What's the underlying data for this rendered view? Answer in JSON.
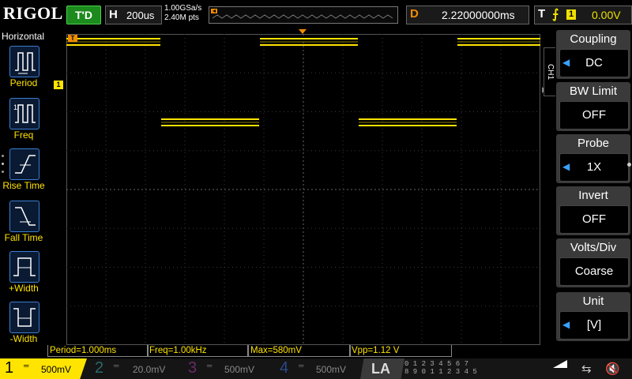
{
  "top": {
    "logo": "RIGOL",
    "run_state": "T'D",
    "horizontal_key": "H",
    "timebase": "200us",
    "sample_rate": "1.00GSa/s",
    "memory_points": "2.40M pts",
    "delay_key": "D",
    "delay_value": "2.22000000ms",
    "trigger_key": "T",
    "trigger_channel": "1",
    "trigger_level": "0.00V"
  },
  "left_menu": {
    "title": "Horizontal",
    "items": [
      {
        "label": "Period"
      },
      {
        "label": "Freq"
      },
      {
        "label": "Rise Time"
      },
      {
        "label": "Fall Time"
      },
      {
        "label": "+Width"
      },
      {
        "label": "-Width"
      }
    ]
  },
  "right_menu": {
    "channel_tab": "CH1",
    "items": [
      {
        "title": "Coupling",
        "value": "DC"
      },
      {
        "title": "BW Limit",
        "value": "OFF"
      },
      {
        "title": "Probe",
        "value": "1X"
      },
      {
        "title": "Invert",
        "value": "OFF"
      },
      {
        "title": "Volts/Div",
        "value": "Coarse"
      },
      {
        "title": "Unit",
        "value": "[V]"
      }
    ]
  },
  "markers": {
    "trigger_marker": "T",
    "ch1_marker": "1"
  },
  "measurements": {
    "period": "Period=1.000ms",
    "freq": "Freq=1.00kHz",
    "max": "Max=580mV",
    "vpp": "Vpp=1.12 V"
  },
  "channels": [
    {
      "num": "1",
      "scale": "500mV",
      "color": "#ffe400"
    },
    {
      "num": "2",
      "scale": "20.0mV",
      "color": "#00a0a0"
    },
    {
      "num": "3",
      "scale": "500mV",
      "color": "#c000c0"
    },
    {
      "num": "4",
      "scale": "500mV",
      "color": "#2f6fd8"
    }
  ],
  "la": {
    "label": "LA",
    "digits_row1": "0 1 2 3  4 5 6 7",
    "digits_row2": "8 9 0 1  1 2 3 4 5"
  },
  "waveform": {
    "color": "#ffe400",
    "high_level_v": 0.58,
    "low_level_v": -0.54,
    "period_ms": 1.0
  }
}
